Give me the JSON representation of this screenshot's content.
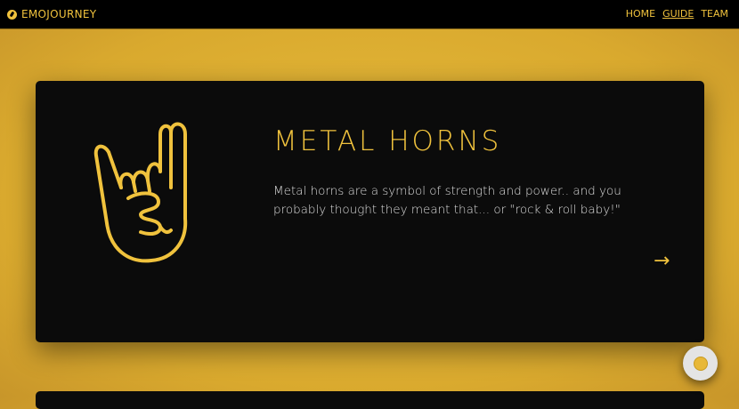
{
  "nav": {
    "brand": "EMOJOURNEY",
    "links": [
      "HOME",
      "GUIDE",
      "TEAM"
    ],
    "active": "GUIDE"
  },
  "card": {
    "title": "METAL HORNS",
    "description": "Metal horns are a symbol of strength and power.. and you probably thought they meant that... or \"rock & roll baby!\"",
    "icon": "metal-horns-hand-icon",
    "next": "arrow-right-icon"
  },
  "colors": {
    "accent": "#f0c23d",
    "card": "#0b0b0b",
    "background": "#e0b236"
  }
}
